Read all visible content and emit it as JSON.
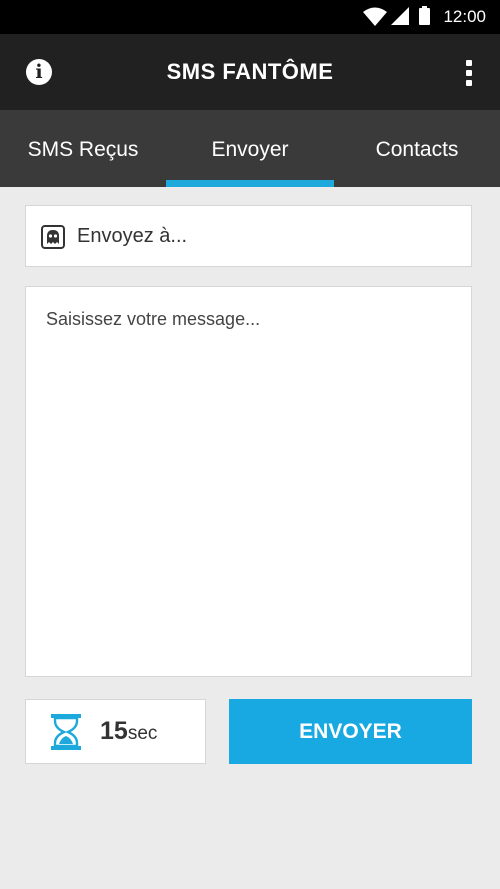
{
  "status_bar": {
    "time": "12:00",
    "icons": [
      "wifi-icon",
      "signal-icon",
      "battery-icon"
    ]
  },
  "app_bar": {
    "title": "SMS FANTÔME",
    "left_icon": "info-icon",
    "right_icon": "overflow-menu-icon"
  },
  "tabs": [
    {
      "label": "SMS Reçus",
      "selected": false
    },
    {
      "label": "Envoyer",
      "selected": true
    },
    {
      "label": "Contacts",
      "selected": false
    }
  ],
  "compose": {
    "recipient_placeholder": "Envoyez à...",
    "recipient_icon": "ghost-icon",
    "message_placeholder": "Saisissez votre message..."
  },
  "timer": {
    "icon": "hourglass-icon",
    "value": "15",
    "unit": "sec"
  },
  "send_button": {
    "label": "ENVOYER"
  },
  "colors": {
    "accent": "#1da9dc",
    "app_bar": "#212121",
    "tab_bar": "#3a3a3a",
    "background": "#ebebeb"
  }
}
